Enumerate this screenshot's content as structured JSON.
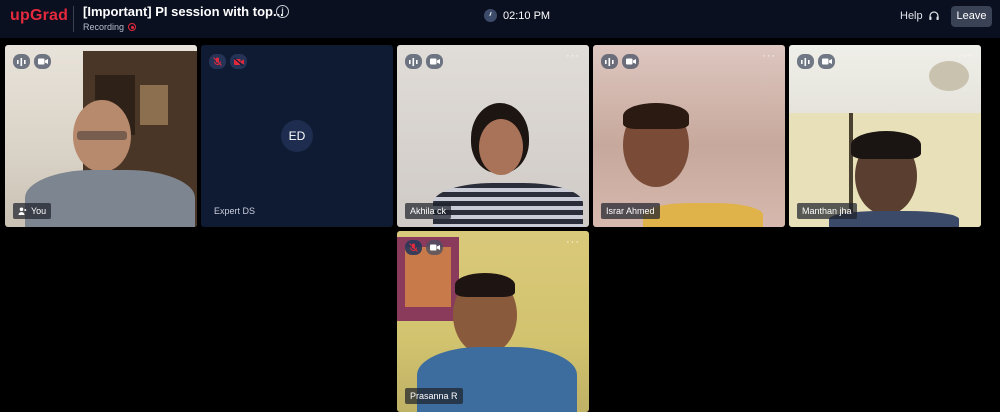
{
  "header": {
    "logo": "upGrad",
    "title": "[Important] PI session with top...",
    "info_icon": "i",
    "recording_label": "Recording",
    "time": "02:10 PM",
    "help_label": "Help",
    "leave_label": "Leave"
  },
  "participants": [
    {
      "name": "You",
      "mic": "on",
      "camera": "on",
      "initials": ""
    },
    {
      "name": "Expert DS",
      "mic": "muted",
      "camera": "off",
      "initials": "ED"
    },
    {
      "name": "Akhila ck",
      "mic": "on",
      "camera": "on",
      "initials": ""
    },
    {
      "name": "Israr Ahmed",
      "mic": "on",
      "camera": "on",
      "initials": ""
    },
    {
      "name": "Manthan jha",
      "mic": "on",
      "camera": "on",
      "initials": ""
    },
    {
      "name": "Prasanna R",
      "mic": "muted",
      "camera": "on",
      "initials": ""
    }
  ],
  "tile_menu_glyph": "···",
  "colors": {
    "brand": "#e5293d",
    "header_bg": "#0b1020",
    "tile_dark": "#0f1a33",
    "leave_button": "#3a4256"
  }
}
